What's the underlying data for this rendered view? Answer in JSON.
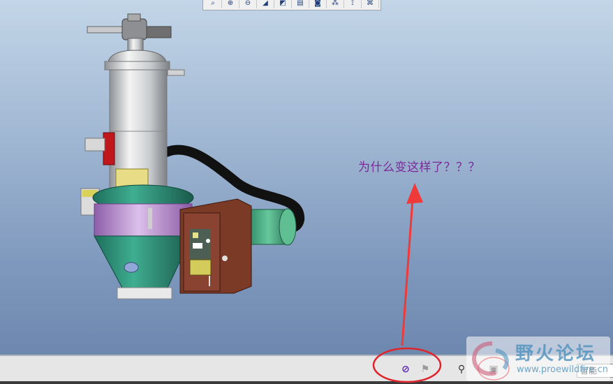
{
  "annotation": {
    "text": "为什么变这样了？？？"
  },
  "toolbar": {
    "buttons": [
      {
        "icon": "zoom-window-icon",
        "glyph": "⌕"
      },
      {
        "icon": "zoom-in-icon",
        "glyph": "⊕"
      },
      {
        "icon": "zoom-out-icon",
        "glyph": "⊖"
      },
      {
        "icon": "orient-icon",
        "glyph": "◢"
      },
      {
        "icon": "saved-views-icon",
        "glyph": "◩"
      },
      {
        "icon": "layers-icon",
        "glyph": "▤"
      },
      {
        "icon": "camera-icon",
        "glyph": "◙"
      },
      {
        "icon": "datum-display-icon",
        "glyph": "⁂"
      },
      {
        "icon": "axis-display-icon",
        "glyph": "⟟"
      },
      {
        "icon": "points-display-icon",
        "glyph": "⌘"
      }
    ]
  },
  "statusbar": {
    "filter_value": "智能"
  },
  "watermark": {
    "title": "野火论坛",
    "url": "www.proewildfire.cn"
  },
  "colors": {
    "annotation": "#7a2a98",
    "arrow": "#f03a3a",
    "highlight": "#e0242c"
  }
}
